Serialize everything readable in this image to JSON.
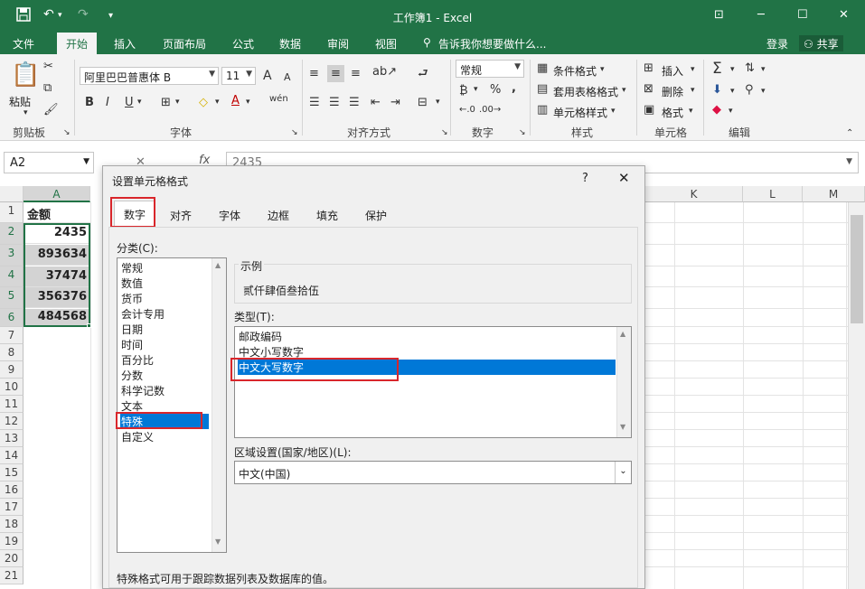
{
  "window": {
    "title": "工作簿1 - Excel"
  },
  "qa": {
    "save_icon": "save-icon",
    "undo": "↶",
    "redo": "↷"
  },
  "menu": {
    "tabs": [
      "文件",
      "开始",
      "插入",
      "页面布局",
      "公式",
      "数据",
      "审阅",
      "视图"
    ],
    "search": "告诉我你想要做什么...",
    "login": "登录",
    "share": "共享"
  },
  "ribbon": {
    "clipboard": {
      "label": "剪贴板",
      "paste": "粘贴"
    },
    "font": {
      "label": "字体",
      "name": "阿里巴巴普惠体 B",
      "size": "11",
      "bold": "B",
      "italic": "I",
      "underline": "U",
      "grow": "A",
      "shrink": "A"
    },
    "align": {
      "label": "对齐方式"
    },
    "number": {
      "label": "数字",
      "format": "常规",
      "percent": "%",
      "comma": ","
    },
    "styles": {
      "label": "样式",
      "cond": "条件格式",
      "table": "套用表格格式",
      "cell": "单元格样式"
    },
    "cells": {
      "label": "单元格",
      "insert": "插入",
      "delete": "删除",
      "format": "格式"
    },
    "editing": {
      "label": "编辑"
    }
  },
  "formula": {
    "namebox": "A2",
    "fx": "fx",
    "value": "2435"
  },
  "sheet": {
    "columns": [
      "A",
      "K",
      "L",
      "M"
    ],
    "rows": [
      "1",
      "2",
      "3",
      "4",
      "5",
      "6",
      "7",
      "8",
      "9",
      "10",
      "11",
      "12",
      "13",
      "14",
      "15",
      "16",
      "17",
      "18",
      "19",
      "20",
      "21"
    ],
    "cells": [
      "金额",
      "2435",
      "893634",
      "37474",
      "356376",
      "484568"
    ]
  },
  "dialog": {
    "title": "设置单元格格式",
    "help": "?",
    "close": "✕",
    "tabs": [
      "数字",
      "对齐",
      "字体",
      "边框",
      "填充",
      "保护"
    ],
    "category_label": "分类(C):",
    "categories": [
      "常规",
      "数值",
      "货币",
      "会计专用",
      "日期",
      "时间",
      "百分比",
      "分数",
      "科学记数",
      "文本",
      "特殊",
      "自定义"
    ],
    "selected_category": "特殊",
    "sample_label": "示例",
    "sample_value": "贰仟肆佰叁拾伍",
    "type_label": "类型(T):",
    "types": [
      "邮政编码",
      "中文小写数字",
      "中文大写数字"
    ],
    "selected_type": "中文大写数字",
    "locale_label": "区域设置(国家/地区)(L):",
    "locale_value": "中文(中国)",
    "description": "特殊格式可用于跟踪数据列表及数据库的值。"
  },
  "colors": {
    "excel_green": "#217346",
    "selection_blue": "#0078d7",
    "highlight_red": "#d9262b"
  }
}
